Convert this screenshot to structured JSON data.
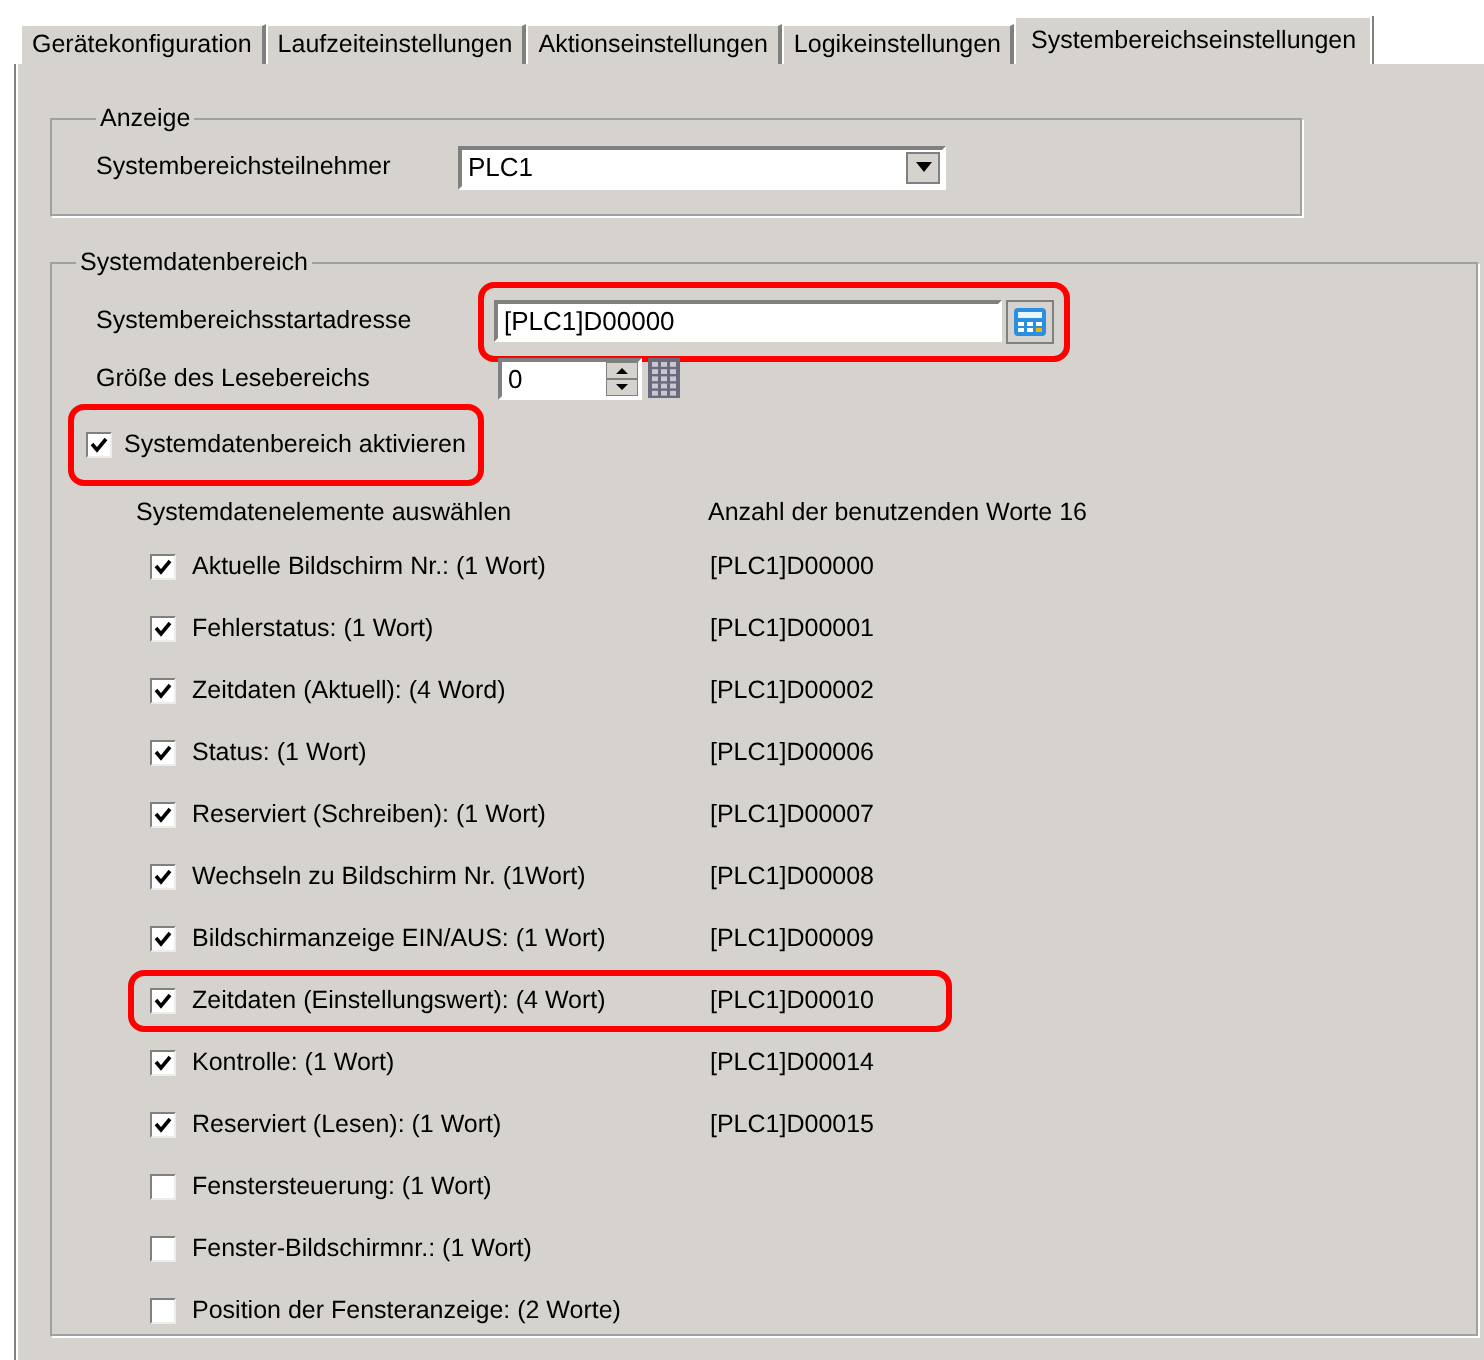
{
  "tabs": [
    {
      "label": "Gerätekonfiguration",
      "selected": false
    },
    {
      "label": "Laufzeiteinstellungen",
      "selected": false
    },
    {
      "label": "Aktionseinstellungen",
      "selected": false
    },
    {
      "label": "Logikeinstellungen",
      "selected": false
    },
    {
      "label": "Systembereichseinstellungen",
      "selected": true
    }
  ],
  "display_group": {
    "title": "Anzeige",
    "participant": {
      "label": "Systembereichsteilnehmer",
      "value": "PLC1"
    }
  },
  "system_data_group": {
    "title": "Systemdatenbereich",
    "start_address": {
      "label": "Systembereichsstartadresse",
      "value": "[PLC1]D00000",
      "highlighted": true
    },
    "read_size": {
      "label": "Größe des Lesebereichs",
      "value": "0"
    },
    "enable": {
      "label": "Systemdatenbereich aktivieren",
      "checked": true,
      "highlighted": true
    },
    "items_header": "Systemdatenelemente auswählen",
    "word_count": "Anzahl der benutzenden Worte 16",
    "items": [
      {
        "label": "Aktuelle Bildschirm Nr.: (1 Wort)",
        "address": "[PLC1]D00000",
        "checked": true,
        "highlighted": false
      },
      {
        "label": "Fehlerstatus: (1 Wort)",
        "address": "[PLC1]D00001",
        "checked": true,
        "highlighted": false
      },
      {
        "label": "Zeitdaten (Aktuell): (4 Word)",
        "address": "[PLC1]D00002",
        "checked": true,
        "highlighted": false
      },
      {
        "label": "Status: (1 Wort)",
        "address": "[PLC1]D00006",
        "checked": true,
        "highlighted": false
      },
      {
        "label": "Reserviert (Schreiben): (1 Wort)",
        "address": "[PLC1]D00007",
        "checked": true,
        "highlighted": false
      },
      {
        "label": "Wechseln zu Bildschirm Nr. (1Wort)",
        "address": "[PLC1]D00008",
        "checked": true,
        "highlighted": false
      },
      {
        "label": "Bildschirmanzeige EIN/AUS: (1 Wort)",
        "address": "[PLC1]D00009",
        "checked": true,
        "highlighted": false
      },
      {
        "label": "Zeitdaten (Einstellungswert): (4 Wort)",
        "address": "[PLC1]D00010",
        "checked": true,
        "highlighted": true
      },
      {
        "label": "Kontrolle: (1 Wort)",
        "address": "[PLC1]D00014",
        "checked": true,
        "highlighted": false
      },
      {
        "label": "Reserviert (Lesen): (1 Wort)",
        "address": "[PLC1]D00015",
        "checked": true,
        "highlighted": false
      },
      {
        "label": "Fenstersteuerung: (1 Wort)",
        "checked": false,
        "highlighted": false
      },
      {
        "label": "Fenster-Bildschirmnr.: (1 Wort)",
        "checked": false,
        "highlighted": false
      },
      {
        "label": "Position der Fensteranzeige: (2 Worte)",
        "checked": false,
        "highlighted": false
      }
    ]
  }
}
